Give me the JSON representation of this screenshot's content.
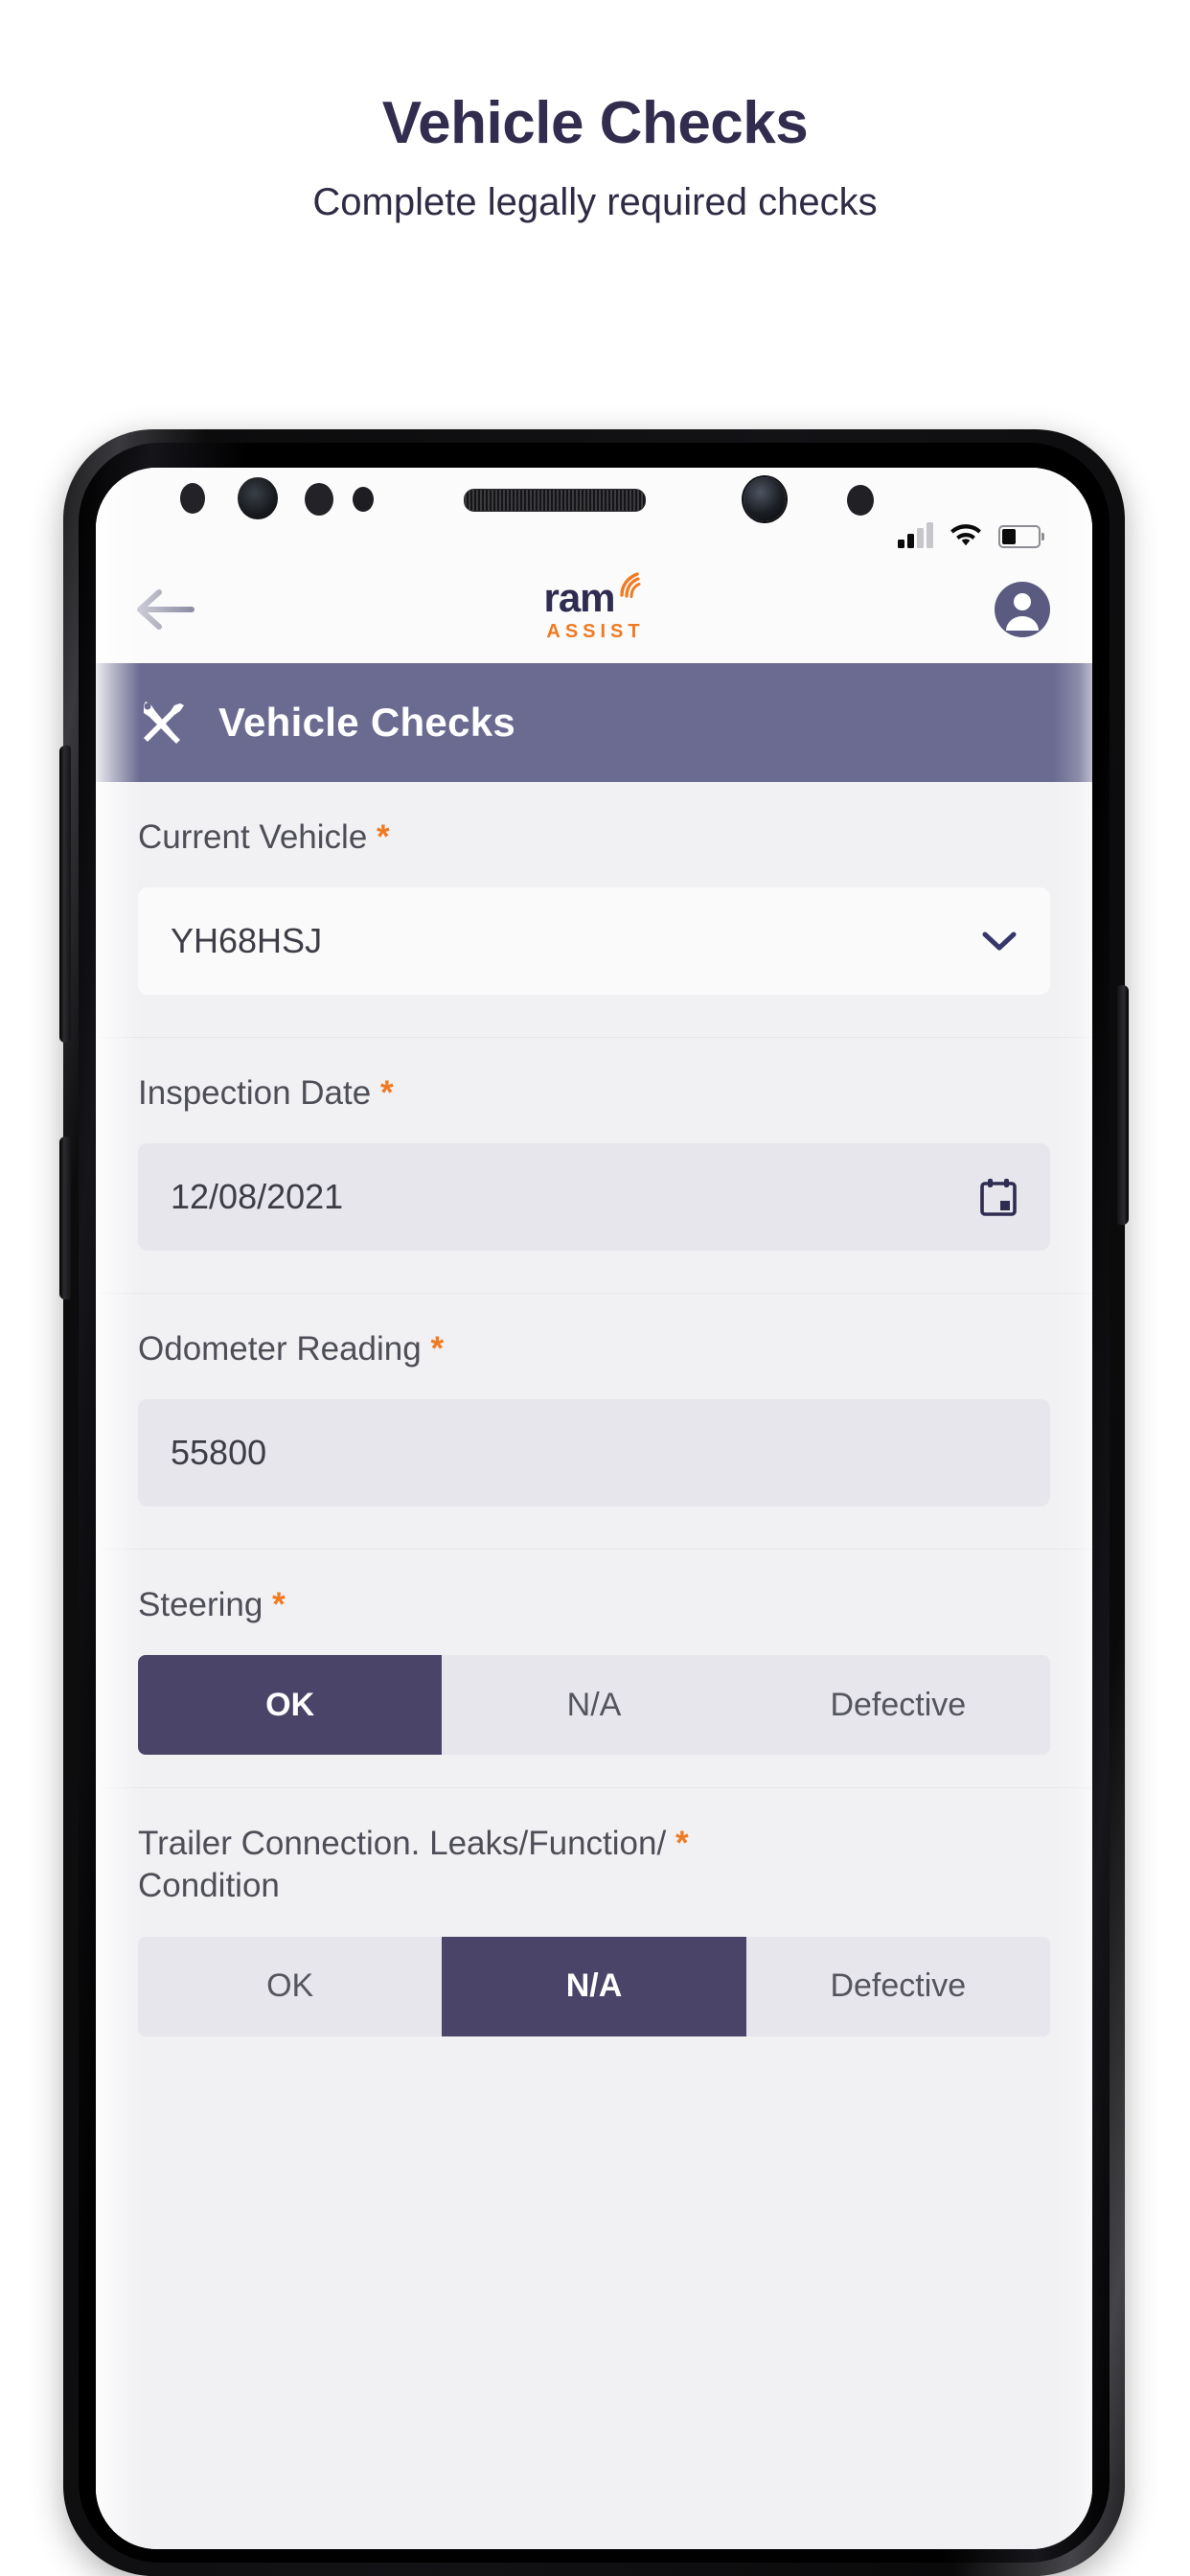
{
  "promo": {
    "title": "Vehicle Checks",
    "subtitle": "Complete legally required checks"
  },
  "colors": {
    "promo_title": "#322c4f",
    "pagebar": "#6b6b92",
    "accent_orange": "#f07a22",
    "selected_purple": "#494468",
    "logo_navy": "#2f2c52"
  },
  "statusbar": {
    "signal_icon": "signal-bars-icon",
    "signal_bars_filled": 2,
    "signal_bars_total": 4,
    "wifi_icon": "wifi-icon",
    "battery_icon": "battery-icon",
    "battery_level_pct": 40
  },
  "appbar": {
    "back_icon": "arrow-left-icon",
    "logo_primary": "ram",
    "logo_secondary": "ASSIST",
    "logo_wave_icon": "signal-wave-icon",
    "account_icon": "account-circle-icon"
  },
  "pagebar": {
    "icon": "tools-icon",
    "title": "Vehicle Checks"
  },
  "form": {
    "required_marker": "*",
    "fields": [
      {
        "label": "Current Vehicle",
        "required": true,
        "type": "select",
        "value": "YH68HSJ",
        "icon": "chevron-down-icon"
      },
      {
        "label": "Inspection Date",
        "required": true,
        "type": "date",
        "value": "12/08/2021",
        "icon": "calendar-icon"
      },
      {
        "label": "Odometer Reading",
        "required": true,
        "type": "number",
        "value": "55800",
        "icon": ""
      },
      {
        "label": "Steering",
        "required": true,
        "type": "segmented",
        "options": [
          "OK",
          "N/A",
          "Defective"
        ],
        "selected": "OK"
      },
      {
        "label": "Trailer Connection. Leaks/Function/ Condition",
        "label_line1": "Trailer Connection. Leaks/Function/",
        "label_line2": "Condition",
        "required": true,
        "type": "segmented",
        "options": [
          "OK",
          "N/A",
          "Defective"
        ],
        "selected": "N/A"
      }
    ]
  }
}
